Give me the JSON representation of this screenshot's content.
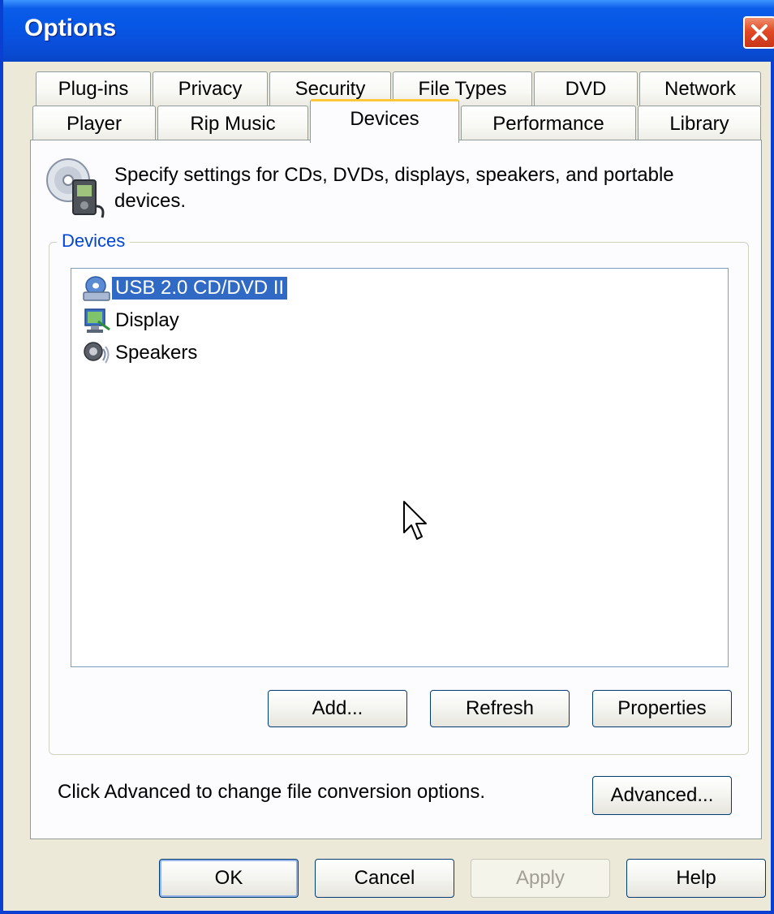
{
  "window": {
    "title": "Options",
    "close_icon": "close-icon"
  },
  "tabs": {
    "row_back": [
      "Plug-ins",
      "Privacy",
      "Security",
      "File Types",
      "DVD",
      "Network"
    ],
    "row_front": [
      "Player",
      "Rip Music",
      "Devices",
      "Performance",
      "Library"
    ],
    "active": "Devices"
  },
  "page": {
    "icon": "devices-cd-player-icon",
    "description": "Specify settings for CDs, DVDs, displays, speakers, and portable devices."
  },
  "devices_group": {
    "label": "Devices",
    "items": [
      {
        "label": "USB 2.0 CD/DVD II",
        "icon": "cd-drive-icon",
        "selected": true
      },
      {
        "label": "Display",
        "icon": "display-icon",
        "selected": false
      },
      {
        "label": "Speakers",
        "icon": "speaker-icon",
        "selected": false
      }
    ],
    "buttons": {
      "add": "Add...",
      "refresh": "Refresh",
      "properties": "Properties"
    }
  },
  "advanced": {
    "hint": "Click Advanced to change file conversion options.",
    "button": "Advanced..."
  },
  "footer": {
    "ok": "OK",
    "cancel": "Cancel",
    "apply": "Apply",
    "help": "Help",
    "apply_enabled": false
  },
  "colors": {
    "titlebar": "#0a4fdc",
    "dialog_bg": "#ece9d8",
    "selection": "#316ac5",
    "group_label": "#0046d5",
    "active_tab_accent": "#ffc83c",
    "close_button": "#e04a25"
  }
}
